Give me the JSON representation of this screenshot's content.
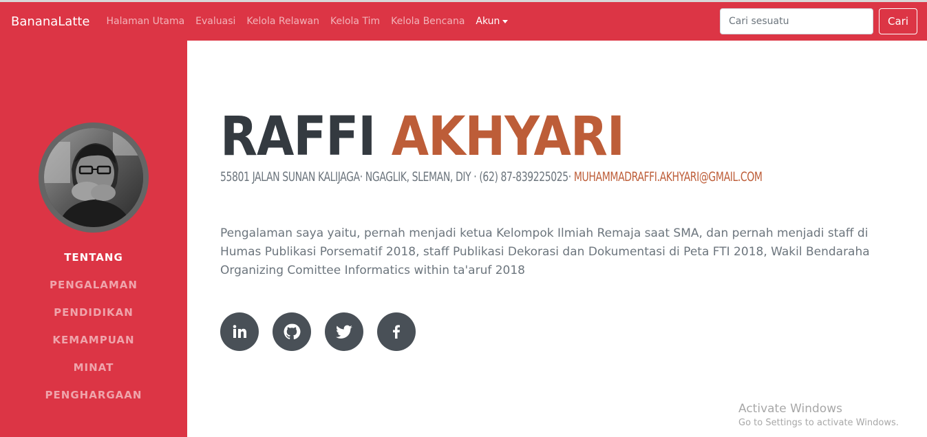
{
  "navbar": {
    "brand": "BananaLatte",
    "links": [
      "Halaman Utama",
      "Evaluasi",
      "Kelola Relawan",
      "Kelola Tim",
      "Kelola Bencana"
    ],
    "account": "Akun",
    "search_placeholder": "Cari sesuatu",
    "search_button": "Cari"
  },
  "sidebar": {
    "items": [
      "TENTANG",
      "PENGALAMAN",
      "PENDIDIKAN",
      "KEMAMPUAN",
      "MINAT",
      "PENGHARGAAN"
    ],
    "active_item": "TENTANG"
  },
  "profile": {
    "first_name": "RAFFI",
    "last_name": "AKHYARI",
    "address": "55801 JALAN SUNAN KALIJAGA· NGAGLIK, SLEMAN, DIY · (62) 87-839225025· ",
    "email": "MUHAMMADRAFFI.AKHYARI@GMAIL.COM",
    "about": "Pengalaman saya yaitu, pernah menjadi ketua Kelompok Ilmiah Remaja saat SMA, dan pernah menjadi staff di Humas Publikasi Porsematif 2018, staff Publikasi Dekorasi dan Dokumentasi di Peta FTI 2018, Wakil Bendaraha Organizing Comittee Informatics within ta'aruf 2018"
  },
  "socials": [
    "linkedin-icon",
    "github-icon",
    "twitter-icon",
    "facebook-icon"
  ],
  "watermark": {
    "title": "Activate Windows",
    "subtitle": "Go to Settings to activate Windows."
  },
  "colors": {
    "primary": "#dc3545",
    "accent": "#bd5d38",
    "dark": "#343a40",
    "social_bg": "#495057"
  }
}
